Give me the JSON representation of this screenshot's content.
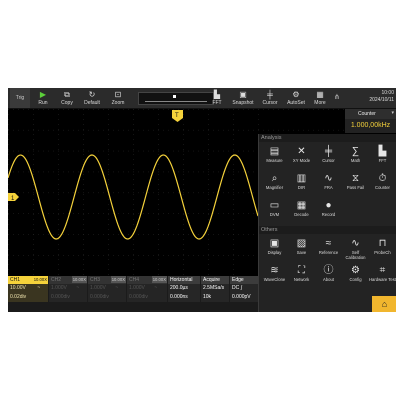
{
  "toolbar": {
    "trig": "Trig",
    "buttons": [
      {
        "label": "Run",
        "icon": "play-icon"
      },
      {
        "label": "Copy",
        "icon": "copy-icon"
      },
      {
        "label": "Default",
        "icon": "reset-icon"
      },
      {
        "label": "Zoom",
        "icon": "zoom-icon"
      },
      {
        "label": "FFT",
        "icon": "fft-icon"
      },
      {
        "label": "Snapshot",
        "icon": "snapshot-icon"
      },
      {
        "label": "Cursor",
        "icon": "cursor-icon"
      },
      {
        "label": "AutoSet",
        "icon": "autoset-icon"
      },
      {
        "label": "More",
        "icon": "more-icon"
      }
    ],
    "time": "10:00",
    "date": "2024/10/11"
  },
  "channel_marker": "1",
  "trigger_marker": "T",
  "counter": {
    "title": "Counter",
    "value": "1.000,00kHz"
  },
  "panel": {
    "analysis_title": "Analysis",
    "analysis_items": [
      {
        "label": "Measure",
        "icon": "measure-icon"
      },
      {
        "label": "XY Mode",
        "icon": "xy-mode-icon"
      },
      {
        "label": "Cursor",
        "icon": "cursor-icon"
      },
      {
        "label": "Math",
        "icon": "math-icon"
      },
      {
        "label": "FFT",
        "icon": "fft-icon"
      },
      {
        "label": "Magnifier",
        "icon": "magnifier-icon"
      },
      {
        "label": "DIR",
        "icon": "dir-icon"
      },
      {
        "label": "FRA",
        "icon": "fra-icon"
      },
      {
        "label": "Pass Fail",
        "icon": "pass-fail-icon"
      },
      {
        "label": "Counter",
        "icon": "counter-icon"
      },
      {
        "label": "DVM",
        "icon": "dvm-icon"
      },
      {
        "label": "Decode",
        "icon": "decode-icon"
      },
      {
        "label": "Record",
        "icon": "record-icon"
      }
    ],
    "others_title": "Others",
    "others_items": [
      {
        "label": "Display",
        "icon": "display-icon"
      },
      {
        "label": "Save",
        "icon": "save-icon"
      },
      {
        "label": "Reference",
        "icon": "reference-icon"
      },
      {
        "label": "Self Calibration",
        "icon": "self-calibration-icon"
      },
      {
        "label": "ProbeCh",
        "icon": "probe-icon"
      },
      {
        "label": "WaveClone",
        "icon": "waveclone-icon"
      },
      {
        "label": "Network",
        "icon": "network-icon"
      },
      {
        "label": "About",
        "icon": "about-icon"
      },
      {
        "label": "Config",
        "icon": "config-icon"
      },
      {
        "label": "Hardware Test",
        "icon": "hardware-test-icon"
      }
    ]
  },
  "bottom": {
    "ch1": {
      "name": "CH1",
      "tag": "10.00X",
      "v1": "10.00V",
      "coupling": "~",
      "v2": "0.02div"
    },
    "ch2": {
      "name": "CH2",
      "tag": "10.00X",
      "v1": "1.000V",
      "coupling": "~",
      "v2": "0.000div"
    },
    "ch3": {
      "name": "CH3",
      "tag": "10.00X",
      "v1": "1.000V",
      "coupling": "~",
      "v2": "0.000div"
    },
    "ch4": {
      "name": "CH4",
      "tag": "10.00X",
      "v1": "1.000V",
      "coupling": "~",
      "v2": "0.000div"
    },
    "horizontal": {
      "title": "Horizontal",
      "v1": "200.0µs",
      "v2": "0.000ns"
    },
    "acquire": {
      "title": "Acquire",
      "v1": "2.5MSa/s",
      "v2": "10k"
    },
    "edge": {
      "title": "Edge",
      "v1": "DC ∫",
      "v2": "0.000pV"
    }
  },
  "colors": {
    "ch1": "#f5d23b",
    "background": "#000000",
    "panel": "#232323",
    "home": "#f1b62e"
  },
  "wave": {
    "cycles_visible": 3.5,
    "amplitude_div": 1.0
  }
}
